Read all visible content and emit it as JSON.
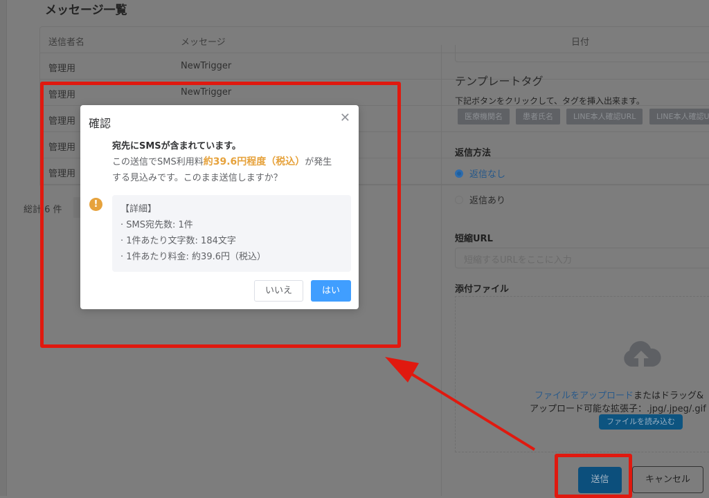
{
  "page": {
    "title": "メッセージ一覧"
  },
  "table": {
    "headers": [
      "送信者名",
      "メッセージ",
      "日付"
    ],
    "rows": [
      {
        "sender": "管理用",
        "message": "NewTrigger"
      },
      {
        "sender": "管理用",
        "message": "NewTrigger"
      },
      {
        "sender": "管理用",
        "message": ""
      },
      {
        "sender": "管理用",
        "message": ""
      },
      {
        "sender": "管理用",
        "message": ""
      }
    ],
    "total": "総計 6 件"
  },
  "form": {
    "template_tag_title": "テンプレートタグ",
    "template_tag_hint": "下記ボタンをクリックして、タグを挿入出来ます。",
    "tags": [
      "医療機関名",
      "患者氏名",
      "LINE本人確認URL",
      "LINE本人確認URL"
    ],
    "reply_label": "返信方法",
    "reply_options": [
      "返信なし",
      "返信あり"
    ],
    "reply_selected": "返信なし",
    "short_url_label": "短縮URL",
    "short_url_placeholder": "短縮するURLをここに入力",
    "attach_label": "添付ファイル",
    "upload_link": "ファイルをアップロード",
    "upload_text": "またはドラッグ&",
    "upload_ext": "アップロード可能な拡張子：.jpg/.jpeg/.gif",
    "upload_button": "ファイルを読み込む",
    "send": "送信",
    "cancel": "キャンセル"
  },
  "dialog": {
    "title": "確認",
    "line1": "宛先にSMSが含まれています。",
    "line2_pre": "この送信でSMS利用料",
    "line2_highlight": "約39.6円程度（税込）",
    "line2_post": "が発生",
    "line3": "する見込みです。このまま送信しますか？",
    "detail_title": "【詳細】",
    "details": [
      "· SMS宛先数: 1件",
      "· 1件あたり文字数: 184文字",
      "· 1件あたり料金: 約39.6円（税込）"
    ],
    "no": "いいえ",
    "yes": "はい"
  },
  "colors": {
    "accent": "#409eff",
    "warning": "#e6a23c",
    "annotation": "#e0190f"
  }
}
